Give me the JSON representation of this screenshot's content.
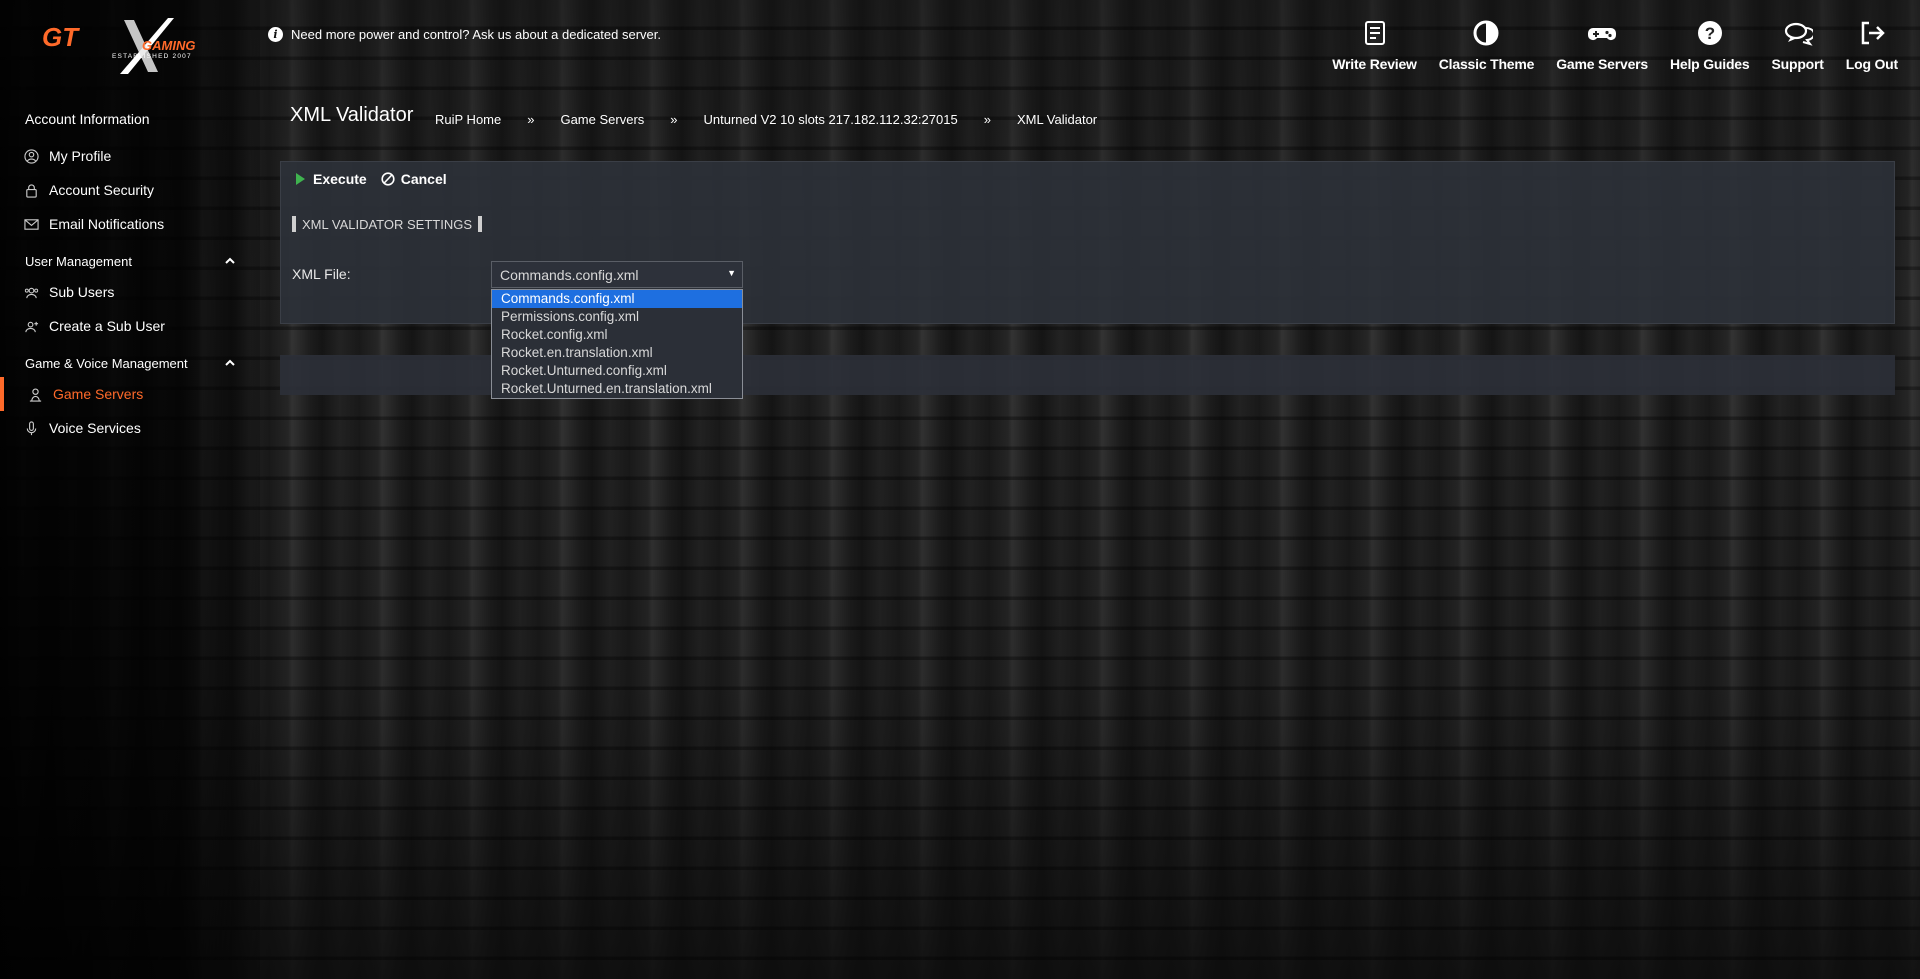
{
  "header": {
    "logo_text": "GTX GAMING",
    "logo_subtext": "ESTABLISHED 2007",
    "promo_text": "Need more power and control? Ask us about a dedicated server.",
    "nav": [
      {
        "label": "Write Review",
        "icon": "review-icon"
      },
      {
        "label": "Classic Theme",
        "icon": "contrast-icon"
      },
      {
        "label": "Game Servers",
        "icon": "gamepad-icon"
      },
      {
        "label": "Help Guides",
        "icon": "help-icon"
      },
      {
        "label": "Support",
        "icon": "chat-icon"
      },
      {
        "label": "Log Out",
        "icon": "logout-icon"
      }
    ]
  },
  "sidebar": {
    "account_heading": "Account Information",
    "account_items": [
      {
        "label": "My Profile",
        "icon": "user-circle-icon"
      },
      {
        "label": "Account Security",
        "icon": "lock-icon"
      },
      {
        "label": "Email Notifications",
        "icon": "envelope-icon"
      }
    ],
    "user_heading": "User Management",
    "user_items": [
      {
        "label": "Sub Users",
        "icon": "users-icon"
      },
      {
        "label": "Create a Sub User",
        "icon": "user-plus-icon"
      }
    ],
    "game_heading": "Game & Voice Management",
    "game_items": [
      {
        "label": "Game Servers",
        "icon": "server-user-icon",
        "active": true
      },
      {
        "label": "Voice Services",
        "icon": "microphone-icon"
      }
    ]
  },
  "main": {
    "title": "XML Validator",
    "breadcrumb": [
      "RuiP Home",
      "Game Servers",
      "Unturned V2 10 slots 217.182.112.32:27015",
      "XML Validator"
    ],
    "breadcrumb_sep": "»",
    "toolbar": {
      "execute_label": "Execute",
      "cancel_label": "Cancel"
    },
    "section_title": "XML VALIDATOR SETTINGS",
    "field_label": "XML File:",
    "select_value": "Commands.config.xml",
    "options": [
      "Commands.config.xml",
      "Permissions.config.xml",
      "Rocket.config.xml",
      "Rocket.en.translation.xml",
      "Rocket.Unturned.config.xml",
      "Rocket.Unturned.en.translation.xml"
    ],
    "selected_index": 0
  },
  "colors": {
    "accent": "#ff6a2a",
    "panel": "#2c3038",
    "selection": "#1e6fe0"
  }
}
